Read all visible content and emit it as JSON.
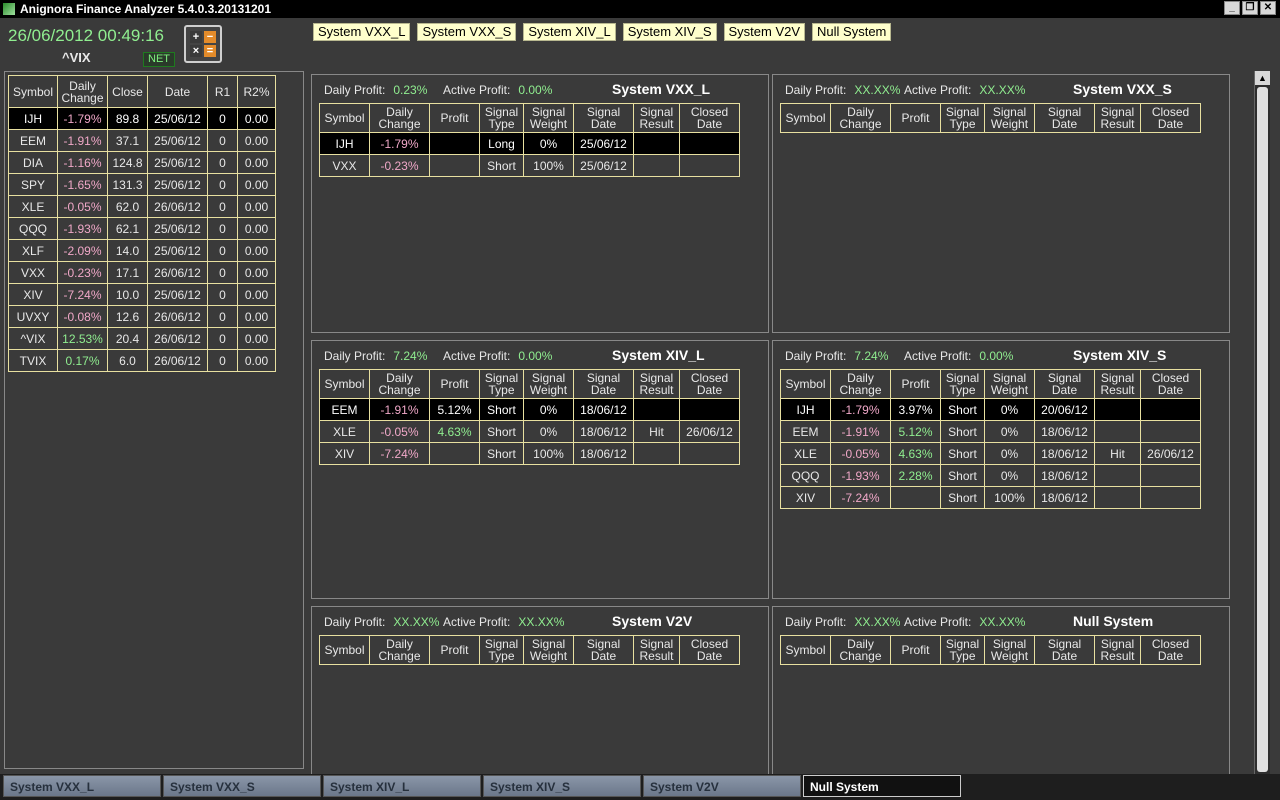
{
  "window": {
    "title": "Anignora Finance Analyzer  5.4.0.3.20131201",
    "buttons": [
      "_",
      "❐",
      "✕"
    ]
  },
  "header": {
    "datetime": "26/06/2012 00:49:16",
    "index": "^VIX",
    "net_label": "NET",
    "calc_keys": [
      "+",
      "−",
      "×",
      "="
    ]
  },
  "system_buttons": [
    "System VXX_L",
    "System VXX_S",
    "System XIV_L",
    "System XIV_S",
    "System V2V",
    "Null System"
  ],
  "watchlist": {
    "columns": [
      "Symbol",
      "Daily Change",
      "Close",
      "Date",
      "R1",
      "R2%"
    ],
    "rows": [
      [
        "IJH",
        "-1.79%",
        "89.8",
        "25/06/12",
        "0",
        "0.00"
      ],
      [
        "EEM",
        "-1.91%",
        "37.1",
        "25/06/12",
        "0",
        "0.00"
      ],
      [
        "DIA",
        "-1.16%",
        "124.8",
        "25/06/12",
        "0",
        "0.00"
      ],
      [
        "SPY",
        "-1.65%",
        "131.3",
        "25/06/12",
        "0",
        "0.00"
      ],
      [
        "XLE",
        "-0.05%",
        "62.0",
        "26/06/12",
        "0",
        "0.00"
      ],
      [
        "QQQ",
        "-1.93%",
        "62.1",
        "25/06/12",
        "0",
        "0.00"
      ],
      [
        "XLF",
        "-2.09%",
        "14.0",
        "25/06/12",
        "0",
        "0.00"
      ],
      [
        "VXX",
        "-0.23%",
        "17.1",
        "26/06/12",
        "0",
        "0.00"
      ],
      [
        "XIV",
        "-7.24%",
        "10.0",
        "25/06/12",
        "0",
        "0.00"
      ],
      [
        "UVXY",
        "-0.08%",
        "12.6",
        "26/06/12",
        "0",
        "0.00"
      ],
      [
        "^VIX",
        "12.53%",
        "20.4",
        "26/06/12",
        "0",
        "0.00"
      ],
      [
        "TVIX",
        "0.17%",
        "6.0",
        "26/06/12",
        "0",
        "0.00"
      ]
    ]
  },
  "signal_columns": [
    "Symbol",
    "Daily Change",
    "Profit",
    "Signal Type",
    "Signal Weight",
    "Signal Date",
    "Signal Result",
    "Closed Date"
  ],
  "labels": {
    "daily_profit": "Daily Profit:",
    "active_profit": "Active Profit:"
  },
  "panels": [
    {
      "title": "System VXX_L",
      "daily_profit": "0.23%",
      "active_profit": "0.00%",
      "rows": [
        [
          "IJH",
          "-1.79%",
          "",
          "Long",
          "0%",
          "25/06/12",
          "",
          ""
        ],
        [
          "VXX",
          "-0.23%",
          "",
          "Short",
          "100%",
          "25/06/12",
          "",
          ""
        ]
      ]
    },
    {
      "title": "System VXX_S",
      "daily_profit": "XX.XX%",
      "active_profit": "XX.XX%",
      "rows": []
    },
    {
      "title": "System XIV_L",
      "daily_profit": "7.24%",
      "active_profit": "0.00%",
      "rows": [
        [
          "EEM",
          "-1.91%",
          "5.12%",
          "Short",
          "0%",
          "18/06/12",
          "",
          ""
        ],
        [
          "XLE",
          "-0.05%",
          "4.63%",
          "Short",
          "0%",
          "18/06/12",
          "Hit",
          "26/06/12"
        ],
        [
          "XIV",
          "-7.24%",
          "",
          "Short",
          "100%",
          "18/06/12",
          "",
          ""
        ]
      ]
    },
    {
      "title": "System XIV_S",
      "daily_profit": "7.24%",
      "active_profit": "0.00%",
      "rows": [
        [
          "IJH",
          "-1.79%",
          "3.97%",
          "Short",
          "0%",
          "20/06/12",
          "",
          ""
        ],
        [
          "EEM",
          "-1.91%",
          "5.12%",
          "Short",
          "0%",
          "18/06/12",
          "",
          ""
        ],
        [
          "XLE",
          "-0.05%",
          "4.63%",
          "Short",
          "0%",
          "18/06/12",
          "Hit",
          "26/06/12"
        ],
        [
          "QQQ",
          "-1.93%",
          "2.28%",
          "Short",
          "0%",
          "18/06/12",
          "",
          ""
        ],
        [
          "XIV",
          "-7.24%",
          "",
          "Short",
          "100%",
          "18/06/12",
          "",
          ""
        ]
      ]
    },
    {
      "title": "System V2V",
      "daily_profit": "XX.XX%",
      "active_profit": "XX.XX%",
      "rows": []
    },
    {
      "title": "Null System",
      "daily_profit": "XX.XX%",
      "active_profit": "XX.XX%",
      "rows": []
    }
  ],
  "tabs": [
    "System VXX_L",
    "System VXX_S",
    "System XIV_L",
    "System XIV_S",
    "System V2V",
    "Null System"
  ],
  "active_tab": "Null System",
  "scrollbar": {
    "up": "▲",
    "down": "▼"
  },
  "colors": {
    "positive": "#90ee90",
    "negative": "#f0a8c8",
    "button_bg": "#ffffcc",
    "grid": "#e8e0a0"
  }
}
